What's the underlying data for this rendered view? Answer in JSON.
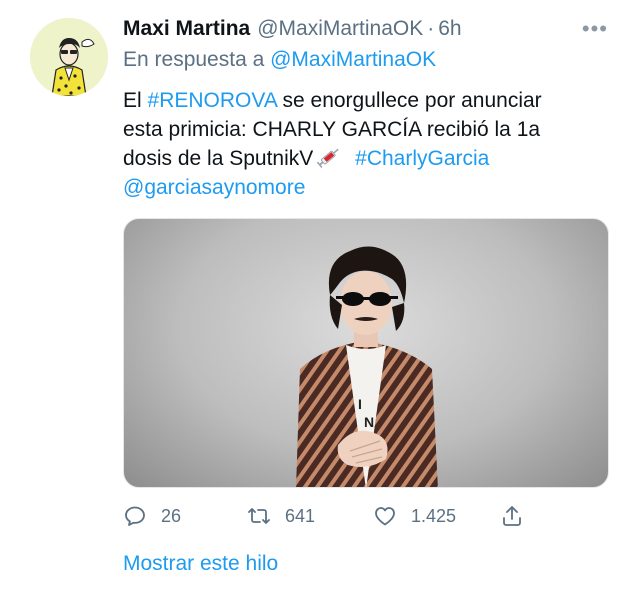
{
  "tweet": {
    "author_name": "Maxi Martina",
    "author_handle": "@MaxiMartinaOK",
    "separator": "·",
    "time": "6h",
    "more_icon": "more-icon",
    "reply_prefix": "En respuesta a",
    "reply_mention": "@MaxiMartinaOK",
    "text": {
      "l1_a": "El ",
      "l1_hashtag": "#RENOROVA",
      "l1_b": " se enorgullece por anunciar",
      "l2": "esta primicia: CHARLY GARCÍA recibió la 1a",
      "l3_a": "dosis de la SputnikV",
      "l3_emoji": "syringe-emoji",
      "l3_hashtag": "#CharlyGarcia",
      "l4_mention": "@garciasaynomore"
    },
    "media": {
      "description_icon": "photo-of-man-with-sunglasses"
    },
    "actions": {
      "reply_count": "26",
      "retweet_count": "641",
      "like_count": "1.425"
    },
    "show_thread": "Mostrar este hilo"
  },
  "colors": {
    "link": "#1d9bf0",
    "secondary_text": "#5b7083",
    "primary_text": "#0f1419"
  }
}
